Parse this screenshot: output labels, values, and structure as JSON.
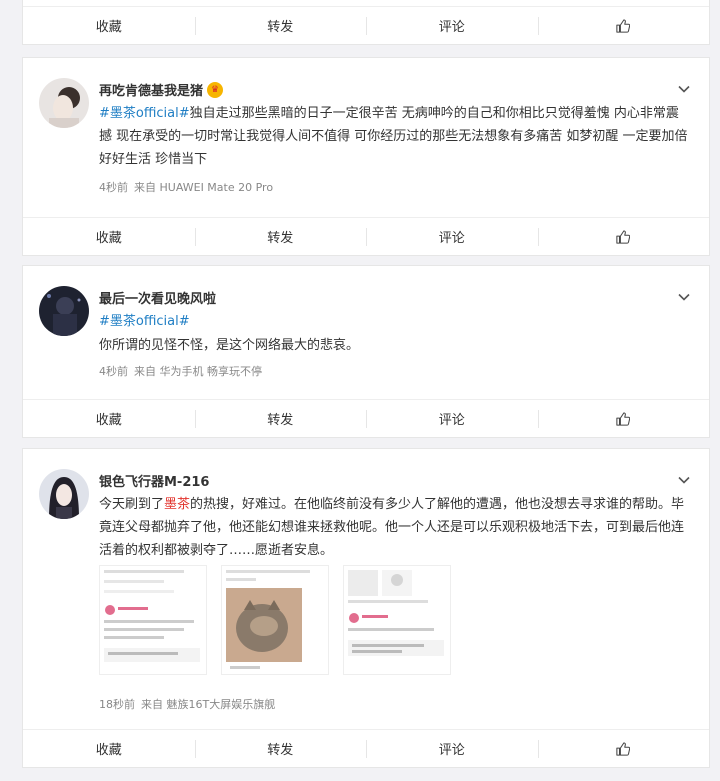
{
  "actions": {
    "favorite": "收藏",
    "repost": "转发",
    "comment": "评论"
  },
  "posts": [
    {
      "username": "再吃肯德基我是猪",
      "topic": "#墨茶official#",
      "body": "独自走过那些黑暗的日子一定很辛苦 无病呻吟的自己和你相比只觉得羞愧 内心非常震撼 现在承受的一切时常让我觉得人间不值得 可你经历过的那些无法想象有多痛苦 如梦初醒 一定要加倍好好生活 珍惜当下",
      "time": "4秒前",
      "source": "来自 HUAWEI Mate 20 Pro"
    },
    {
      "username": "最后一次看见晚风啦",
      "topic": "#墨茶official#",
      "body": "你所谓的见怪不怪，是这个网络最大的悲哀。",
      "time": "4秒前",
      "source": "来自 华为手机 畅享玩不停"
    },
    {
      "username": "银色飞行器M-216",
      "body_pre": "今天刷到了",
      "highlight": "墨茶",
      "body_post": "的热搜，好难过。在他临终前没有多少人了解他的遭遇，他也没想去寻求谁的帮助。毕竟连父母都抛弃了他，他还能幻想谁来拯救他呢。他一个人还是可以乐观积极地活下去，可到最后他连活着的权利都被剥夺了……愿逝者安息。",
      "time": "18秒前",
      "source": "来自 魅族16T大屏娱乐旗舰"
    }
  ]
}
